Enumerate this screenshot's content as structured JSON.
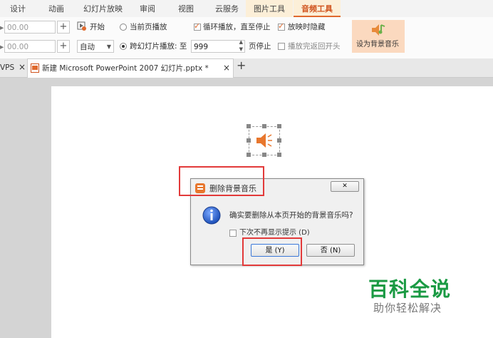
{
  "menu": {
    "tabs": [
      "设计",
      "动画",
      "幻灯片放映",
      "审阅",
      "视图",
      "云服务",
      "图片工具",
      "音频工具"
    ]
  },
  "ribbon": {
    "fade_in_value": "00.00",
    "fade_out_value": "00.00",
    "plus_symbol": "+",
    "start_label": "开始",
    "start_mode": "自动",
    "current_page_label": "当前页播放",
    "cross_slide_label": "跨幻灯片播放: 至",
    "page_count": "999",
    "page_stop_label": "页停止",
    "loop_label": "循环播放，直至停止",
    "hide_label": "放映时隐藏",
    "rewind_label": "播放完返回开头",
    "set_bg_music_label": "设为背景音乐"
  },
  "doc_tabs": {
    "wps_label": "VPS",
    "close_symbol": "×",
    "file_name": "新建 Microsoft PowerPoint 2007 幻灯片.pptx *",
    "new_tab_symbol": "+"
  },
  "dialog": {
    "title": "删除背景音乐",
    "close_symbol": "✕",
    "message": "确实要删除从本页开始的背景音乐吗?",
    "no_remind_label": "下次不再显示提示 (D)",
    "yes_label": "是 (Y)",
    "no_label": "否 (N)"
  },
  "watermark": {
    "title": "百科全说",
    "subtitle": "助你轻松解决"
  },
  "colors": {
    "accent": "#e06a2e",
    "highlight_box": "#e23a3a",
    "watermark_green": "#1a9a43"
  }
}
